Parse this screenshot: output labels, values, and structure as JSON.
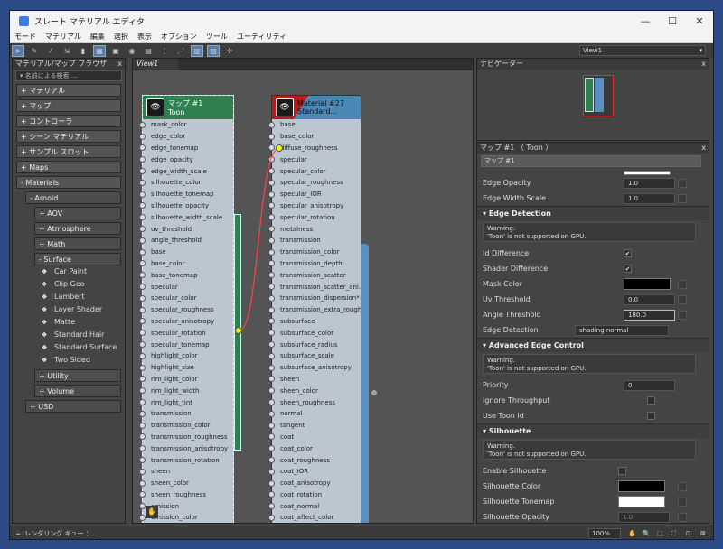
{
  "window": {
    "title": "スレート マテリアル エディタ"
  },
  "menu": [
    "モード",
    "マテリアル",
    "編集",
    "選択",
    "表示",
    "オプション",
    "ツール",
    "ユーティリティ"
  ],
  "view_select": "View1",
  "browser": {
    "title": "マテリアル/マップ ブラウザ",
    "search_placeholder": "名前による検索 ...",
    "groups_top": [
      "+ マテリアル",
      "+ マップ",
      "+ コントローラ",
      "+ シーン マテリアル",
      "+ サンプル スロット",
      "+ Maps"
    ],
    "materials": "- Materials",
    "arnold": "- Arnold",
    "arnold_sub": [
      "+ AOV",
      "+ Atmosphere",
      "+ Math"
    ],
    "surface": "- Surface",
    "surface_items": [
      "Car Paint",
      "Clip Geo",
      "Lambert",
      "Layer Shader",
      "Matte",
      "Standard Hair",
      "Standard Surface",
      "Two Sided"
    ],
    "arnold_sub2": [
      "+ Utility",
      "+ Volume"
    ],
    "usd": "+ USD"
  },
  "graph": {
    "tab": "View1",
    "toon_node": {
      "title": "マップ #1",
      "subtitle": "Toon",
      "slots": [
        "mask_color",
        "edge_color",
        "edge_tonemap",
        "edge_opacity",
        "edge_width_scale",
        "silhouette_color",
        "silhouette_tonemap",
        "silhouette_opacity",
        "silhouette_width_scale",
        "uv_threshold",
        "angle_threshold",
        "base",
        "base_color",
        "base_tonemap",
        "specular",
        "specular_color",
        "specular_roughness",
        "specular_anisotropy",
        "specular_rotation",
        "specular_tonemap",
        "highlight_color",
        "highlight_size",
        "rim_light_color",
        "rim_light_width",
        "rim_light_tint",
        "transmission",
        "transmission_color",
        "transmission_roughness",
        "transmission_anisotropy",
        "transmission_rotation",
        "sheen",
        "sheen_color",
        "sheen_roughness",
        "emission",
        "emission_color"
      ]
    },
    "mat_node": {
      "title": "Material #27",
      "subtitle": "Standard...",
      "slots": [
        "base",
        "base_color",
        "diffuse_roughness",
        "specular",
        "specular_color",
        "specular_roughness",
        "specular_IOR",
        "specular_anisotropy",
        "specular_rotation",
        "metalness",
        "transmission",
        "transmission_color",
        "transmission_depth",
        "transmission_scatter",
        "transmission_scatter_ani...",
        "transmission_dispersion*",
        "transmission_extra_rough...",
        "subsurface",
        "subsurface_color",
        "subsurface_radius",
        "subsurface_scale",
        "subsurface_anisotropy",
        "sheen",
        "sheen_color",
        "sheen_roughness",
        "normal",
        "tangent",
        "coat",
        "coat_color",
        "coat_roughness",
        "coat_IOR",
        "coat_anisotropy",
        "coat_rotation",
        "coat_normal",
        "coat_affect_color"
      ]
    }
  },
  "navigator": {
    "title": "ナビゲーター"
  },
  "props": {
    "title": "マップ #1 （ Toon ）",
    "name_field": "マップ #1",
    "edge_opacity_label": "Edge Opacity",
    "edge_opacity": "1.0",
    "edge_width_label": "Edge Width Scale",
    "edge_width": "1.0",
    "sec_edge": "Edge Detection",
    "warning_label": "Warning.",
    "warning_text": "'Toon' is not supported on GPU.",
    "id_diff": "Id Difference",
    "shader_diff": "Shader Difference",
    "mask_color": "Mask Color",
    "uv_threshold_label": "Uv Threshold",
    "uv_threshold": "0.0",
    "angle_threshold_label": "Angle Threshold",
    "angle_threshold": "180.0",
    "edge_detection_label": "Edge Detection",
    "edge_detection": "shading normal",
    "sec_adv": "Advanced Edge Control",
    "priority_label": "Priority",
    "priority": "0",
    "ignore_throughput": "Ignore Throughput",
    "use_toon_id": "Use Toon Id",
    "sec_sil": "Silhouette",
    "enable_sil": "Enable Silhouette",
    "sil_color": "Silhouette Color",
    "sil_tonemap": "Silhouette Tonemap",
    "sil_opacity_label": "Silhouette Opacity",
    "sil_opacity": "1.0"
  },
  "status": {
    "render_queue": "レンダリング キュー ：...",
    "zoom": "100%"
  },
  "colors": {
    "toon_head": "#2f7f4f",
    "mat_head": "#4a88b6",
    "wire": "#ff4444",
    "socket_active": "#e8f020"
  }
}
